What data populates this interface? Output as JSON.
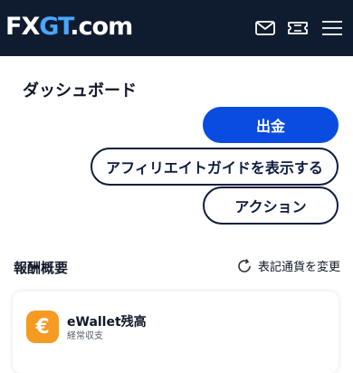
{
  "header": {
    "logo_part1": "FX",
    "logo_part2": "GT",
    "logo_part3": ".com",
    "icons": [
      "mail-icon",
      "ticket-icon",
      "hamburger-menu-icon"
    ],
    "background": "#0f1c2f"
  },
  "dashboard": {
    "title": "ダッシュボード",
    "withdraw_label": "出金",
    "affiliate_guide_label": "アフィリエイトガイドを表示する",
    "action_label": "アクション"
  },
  "reward_summary": {
    "title": "報酬概要",
    "change_currency_label": "表記通貨を変更"
  },
  "ewallet_card": {
    "icon": "euro-icon",
    "icon_symbol": "€",
    "title": "eWallet残高",
    "subtitle": "経常収支"
  },
  "colors": {
    "primary": "#0a4ce0",
    "dark": "#0f1c3f",
    "wallet_accent": "#f59a23"
  }
}
